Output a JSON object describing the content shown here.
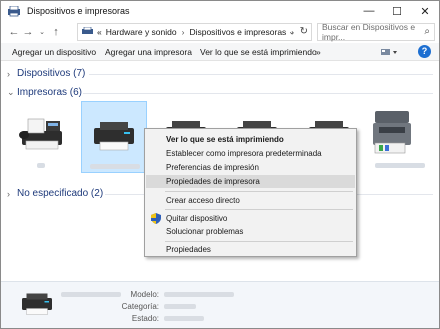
{
  "window": {
    "title": "Dispositivos e impresoras",
    "controls": {
      "minimize": "—",
      "maximize": "☐",
      "close": "✕"
    }
  },
  "address": {
    "root": "«",
    "crumbs": [
      "Hardware y sonido",
      "Dispositivos e impresoras"
    ],
    "separator": "›",
    "search_placeholder": "Buscar en Dispositivos e impr..."
  },
  "toolbar": {
    "add_device": "Agregar un dispositivo",
    "add_printer": "Agregar una impresora",
    "see_printing": "Ver lo que se está imprimiendo",
    "more": "»",
    "help": "?"
  },
  "groups": {
    "devices": "Dispositivos (7)",
    "printers": "Impresoras (6)",
    "unspecified": "No especificado (2)"
  },
  "context_menu": {
    "items": [
      "Ver lo que se está imprimiendo",
      "Establecer como impresora predeterminada",
      "Preferencias de impresión",
      "Propiedades de impresora",
      "Crear acceso directo",
      "Quitar dispositivo",
      "Solucionar problemas",
      "Propiedades"
    ]
  },
  "details": {
    "model_label": "Modelo:",
    "category_label": "Categoría:",
    "status_label": "Estado:"
  },
  "colors": {
    "accent_blue": "#1e3a7b",
    "selection": "#cce8ff",
    "menu_bg": "#f2f2f2",
    "help_blue": "#1d6fd1"
  }
}
